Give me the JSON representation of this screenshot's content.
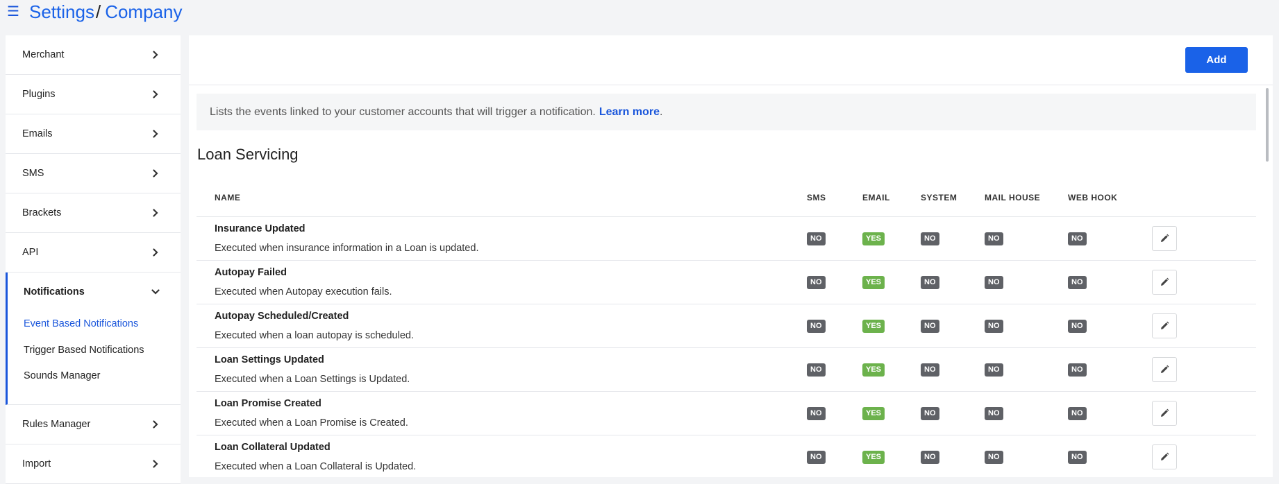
{
  "header": {
    "menu_icon": "hamburger-icon",
    "breadcrumb": [
      "Settings",
      "Company"
    ],
    "separator": "/"
  },
  "sidebar": {
    "items_top": [
      {
        "label": "Merchant"
      },
      {
        "label": "Plugins"
      },
      {
        "label": "Emails"
      },
      {
        "label": "SMS"
      },
      {
        "label": "Brackets"
      },
      {
        "label": "API"
      }
    ],
    "group": {
      "label": "Notifications",
      "sub_items": [
        {
          "label": "Event Based Notifications",
          "active": true
        },
        {
          "label": "Trigger Based Notifications",
          "active": false
        },
        {
          "label": "Sounds Manager",
          "active": false
        }
      ]
    },
    "items_bottom": [
      {
        "label": "Rules Manager"
      },
      {
        "label": "Import"
      }
    ]
  },
  "main": {
    "add_label": "Add",
    "info_text": "Lists the events linked to your customer accounts that will trigger a notification.",
    "learn_more": "Learn more",
    "info_end": ".",
    "section_title": "Loan Servicing",
    "columns": [
      "NAME",
      "SMS",
      "EMAIL",
      "SYSTEM",
      "MAIL HOUSE",
      "WEB HOOK"
    ],
    "rows": [
      {
        "title": "Insurance Updated",
        "desc": "Executed when insurance information in a Loan is updated.",
        "sms": "NO",
        "email": "YES",
        "system": "NO",
        "mail_house": "NO",
        "web_hook": "NO"
      },
      {
        "title": "Autopay Failed",
        "desc": "Executed when Autopay execution fails.",
        "sms": "NO",
        "email": "YES",
        "system": "NO",
        "mail_house": "NO",
        "web_hook": "NO"
      },
      {
        "title": "Autopay Scheduled/Created",
        "desc": "Executed when a loan autopay is scheduled.",
        "sms": "NO",
        "email": "YES",
        "system": "NO",
        "mail_house": "NO",
        "web_hook": "NO"
      },
      {
        "title": "Loan Settings Updated",
        "desc": "Executed when a Loan Settings is Updated.",
        "sms": "NO",
        "email": "YES",
        "system": "NO",
        "mail_house": "NO",
        "web_hook": "NO"
      },
      {
        "title": "Loan Promise Created",
        "desc": "Executed when a Loan Promise is Created.",
        "sms": "NO",
        "email": "YES",
        "system": "NO",
        "mail_house": "NO",
        "web_hook": "NO"
      },
      {
        "title": "Loan Collateral Updated",
        "desc": "Executed when a Loan Collateral is Updated.",
        "sms": "NO",
        "email": "YES",
        "system": "NO",
        "mail_house": "NO",
        "web_hook": "NO"
      }
    ]
  },
  "colors": {
    "accent": "#1a62e8",
    "badge_no": "#5f6166",
    "badge_yes": "#6cb24c"
  }
}
